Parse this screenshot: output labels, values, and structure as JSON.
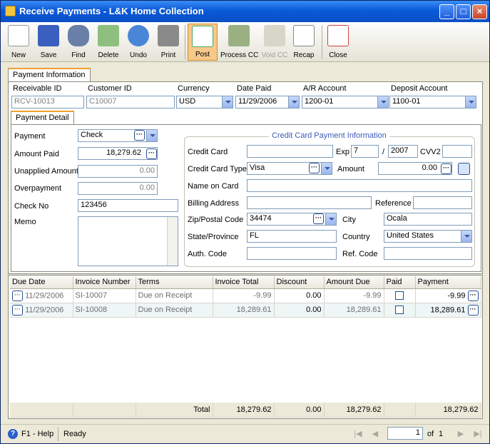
{
  "window": {
    "title": "Receive Payments - L&K Home Collection"
  },
  "toolbar": {
    "new": "New",
    "save": "Save",
    "find": "Find",
    "delete": "Delete",
    "undo": "Undo",
    "print": "Print",
    "post": "Post",
    "process_cc": "Process CC",
    "void_cc": "Void CC",
    "recap": "Recap",
    "close": "Close"
  },
  "tabs": {
    "payment_information": "Payment Information",
    "payment_detail": "Payment Detail"
  },
  "header": {
    "receivable_id_label": "Receivable ID",
    "receivable_id": "RCV-10013",
    "customer_id_label": "Customer ID",
    "customer_id": "C10007",
    "currency_label": "Currency",
    "currency": "USD",
    "date_paid_label": "Date Paid",
    "date_paid": "11/29/2006",
    "ar_account_label": "A/R Account",
    "ar_account": "1200-01",
    "deposit_account_label": "Deposit Account",
    "deposit_account": "1100-01"
  },
  "detail": {
    "payment_label": "Payment",
    "payment": "Check",
    "amount_paid_label": "Amount Paid",
    "amount_paid": "18,279.62",
    "unapplied_label": "Unapplied Amount",
    "unapplied": "0.00",
    "overpayment_label": "Overpayment",
    "overpayment": "0.00",
    "check_no_label": "Check No",
    "check_no": "123456",
    "memo_label": "Memo",
    "memo": ""
  },
  "cc": {
    "group_title": "Credit Card Payment Information",
    "credit_card_label": "Credit Card",
    "credit_card": "",
    "exp_label": "Exp",
    "exp_month": "7",
    "exp_sep": "/",
    "exp_year": "2007",
    "cvv2_label": "CVV2",
    "cvv2": "",
    "type_label": "Credit Card Type",
    "type": "Visa",
    "amount_label": "Amount",
    "amount": "0.00",
    "name_label": "Name on Card",
    "name": "",
    "billing_label": "Billing Address",
    "billing": "",
    "reference_label": "Reference",
    "reference": "",
    "zip_label": "Zip/Postal Code",
    "zip": "34474",
    "city_label": "City",
    "city": "Ocala",
    "state_label": "State/Province",
    "state": "FL",
    "country_label": "Country",
    "country": "United States",
    "auth_label": "Auth. Code",
    "auth": "",
    "ref_code_label": "Ref. Code",
    "ref_code": ""
  },
  "grid": {
    "headers": [
      "Due Date",
      "Invoice Number",
      "Terms",
      "Invoice Total",
      "Discount",
      "Amount Due",
      "Paid",
      "Payment"
    ],
    "rows": [
      {
        "due_date": "11/29/2006",
        "invoice": "SI-10007",
        "terms": "Due on Receipt",
        "total": "-9.99",
        "discount": "0.00",
        "amount_due": "-9.99",
        "payment": "-9.99"
      },
      {
        "due_date": "11/29/2006",
        "invoice": "SI-10008",
        "terms": "Due on Receipt",
        "total": "18,289.61",
        "discount": "0.00",
        "amount_due": "18,289.61",
        "payment": "18,289.61"
      }
    ],
    "totals": {
      "label": "Total",
      "total": "18,279.62",
      "discount": "0.00",
      "amount_due": "18,279.62",
      "payment": "18,279.62"
    }
  },
  "status": {
    "help": "F1 - Help",
    "state": "Ready",
    "page": "1",
    "of": "of",
    "pages": "1"
  }
}
